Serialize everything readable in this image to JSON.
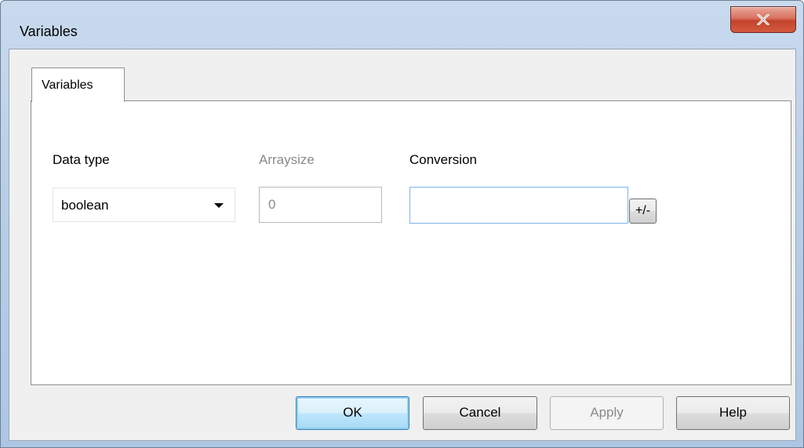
{
  "window": {
    "title": "Variables",
    "close_glyph": "x"
  },
  "tabs": [
    {
      "label": "Variables",
      "selected": true
    }
  ],
  "fields": {
    "data_type": {
      "label": "Data type",
      "value": "boolean",
      "icon": "chevron-down-icon"
    },
    "arraysize": {
      "label": "Arraysize",
      "value": "0",
      "enabled": false
    },
    "conversion": {
      "label": "Conversion",
      "value": "",
      "toggle_label": "+/-"
    }
  },
  "buttons": {
    "ok": "OK",
    "cancel": "Cancel",
    "apply": "Apply",
    "help": "Help"
  },
  "colors": {
    "titlebar": "#b9cfe8",
    "close_button": "#c4432c",
    "default_button_border": "#3c7fb1",
    "focused_input_border": "#7eb4ea",
    "disabled_text": "#8a8a8a"
  }
}
